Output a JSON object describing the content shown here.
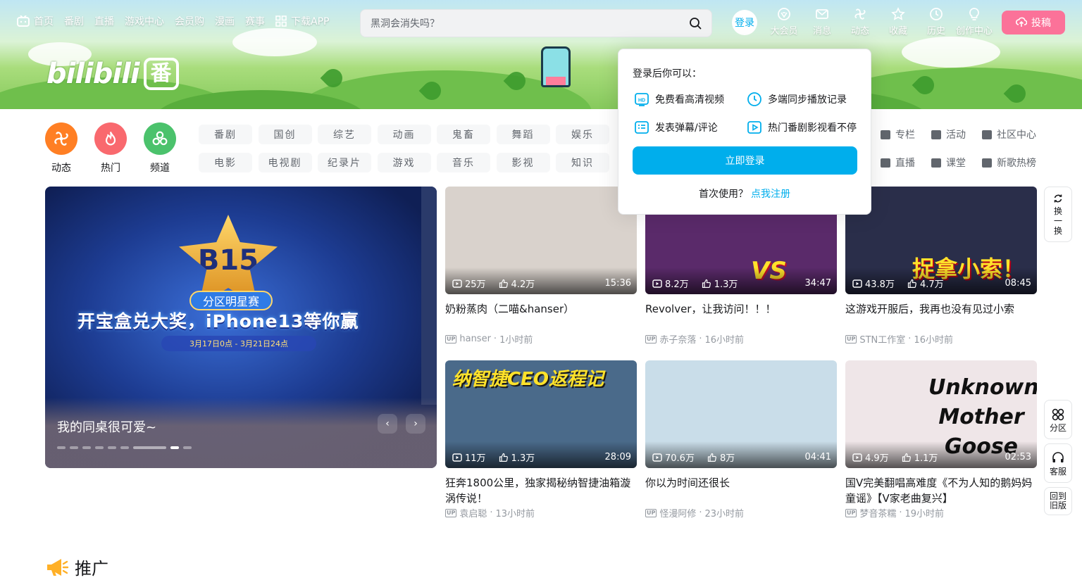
{
  "header": {
    "nav": [
      {
        "label": "首页",
        "icon": "tv-icon"
      },
      {
        "label": "番剧"
      },
      {
        "label": "直播"
      },
      {
        "label": "游戏中心"
      },
      {
        "label": "会员购"
      },
      {
        "label": "漫画"
      },
      {
        "label": "赛事"
      },
      {
        "label": "下载APP",
        "icon": "grid-icon"
      }
    ],
    "search_placeholder": "黑洞会消失吗？",
    "login_label": "登录",
    "right_nav": [
      {
        "label": "大会员",
        "icon": "vip-icon"
      },
      {
        "label": "消息",
        "icon": "mail-icon"
      },
      {
        "label": "动态",
        "icon": "wind-icon"
      },
      {
        "label": "收藏",
        "icon": "star-icon"
      },
      {
        "label": "历史",
        "icon": "clock-icon"
      },
      {
        "label": "创作中心",
        "icon": "bulb-icon"
      }
    ],
    "upload_label": "投稿"
  },
  "banner": {
    "logo_text": "bilibili",
    "logo_badge": "番"
  },
  "channels": {
    "big": [
      {
        "label": "动态",
        "color": "#ff7f24"
      },
      {
        "label": "热门",
        "color": "#f9696e"
      },
      {
        "label": "频道",
        "color": "#4bc26c"
      }
    ],
    "chips": [
      "番剧",
      "国创",
      "综艺",
      "动画",
      "鬼畜",
      "舞蹈",
      "娱乐",
      "电影",
      "电视剧",
      "纪录片",
      "游戏",
      "音乐",
      "影视",
      "知识"
    ],
    "links": [
      "专栏",
      "活动",
      "社区中心",
      "直播",
      "课堂",
      "新歌热榜"
    ]
  },
  "carousel": {
    "caption": "我的同桌很可爱~",
    "badge_text": "B15",
    "badge_sub": "分区明星赛",
    "promo": "开宝盒兑大奖，iPhone13等你赢",
    "promo_date": "3月17日0点 - 3月21日24点",
    "prev": "‹",
    "next": "›"
  },
  "videos": [
    {
      "views": "25万",
      "likes": "4.2万",
      "duration": "15:36",
      "title": "奶粉蒸肉（二喵&hanser）",
      "author": "hanser",
      "time": "1小时前",
      "bg": "#d9d2cc"
    },
    {
      "views": "8.2万",
      "likes": "1.3万",
      "duration": "34:47",
      "title": "Revolver，让我访问！！！",
      "author": "赤子奈落",
      "time": "16小时前",
      "bg": "#5a2a6a",
      "art": "VS"
    },
    {
      "views": "43.8万",
      "likes": "4.7万",
      "duration": "08:45",
      "title": "这游戏开服后，我再也没有见过小索",
      "author": "STN工作室",
      "time": "16小时前",
      "bg": "#2a2e4a",
      "art": "捉拿小索！"
    },
    {
      "views": "11万",
      "likes": "1.3万",
      "duration": "28:09",
      "title": "狂奔1800公里，独家揭秘纳智捷油箱漩涡传说！",
      "author": "袁启聪",
      "time": "13小时前",
      "bg": "#4a6a8a",
      "art": "纳智捷CEO返程记"
    },
    {
      "views": "70.6万",
      "likes": "8万",
      "duration": "04:41",
      "title": "你以为时间还很长",
      "author": "怪漫阿修",
      "time": "23小时前",
      "bg": "#c9dde9"
    },
    {
      "views": "4.9万",
      "likes": "1.1万",
      "duration": "02:53",
      "title": "国V完美翻唱高难度《不为人知的鹅妈妈童谣》【V家老曲复兴】",
      "author": "梦音茶糯",
      "time": "19小时前",
      "bg": "#efe6e8",
      "art": "Unknown Mother Goose"
    }
  ],
  "floats": {
    "refresh": "换一换",
    "zone": "分区",
    "service": "客服",
    "old": "回到旧版"
  },
  "promo_section": {
    "title": "推广"
  },
  "login_popup": {
    "heading": "登录后你可以：",
    "features": [
      "免费看高清视频",
      "多端同步播放记录",
      "发表弹幕/评论",
      "热门番剧影视看不停"
    ],
    "button": "立即登录",
    "first_use": "首次使用？",
    "register": "点我注册"
  },
  "colors": {
    "accent": "#00aeec",
    "pink": "#fb7299"
  }
}
